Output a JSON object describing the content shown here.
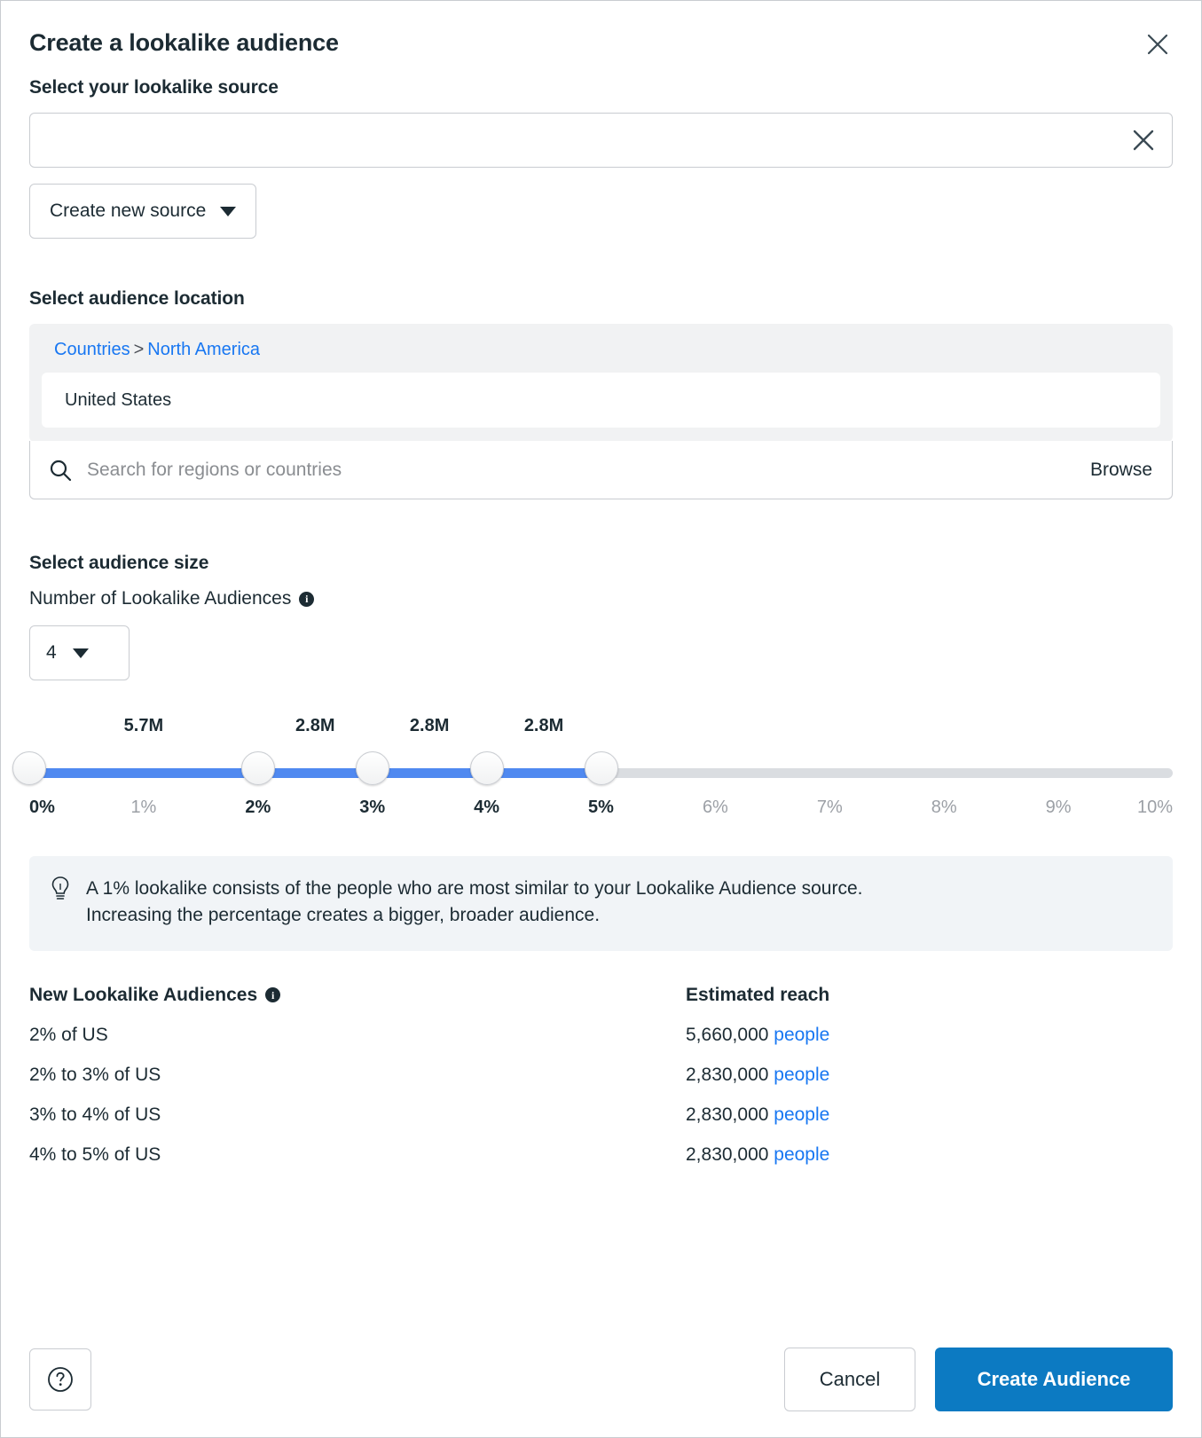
{
  "dialog": {
    "title": "Create a lookalike audience",
    "close_icon": "close-icon"
  },
  "source": {
    "label": "Select your lookalike source",
    "value": "",
    "placeholder": "",
    "clear_icon": "close-icon",
    "create_button": "Create new source"
  },
  "location": {
    "label": "Select audience location",
    "breadcrumb": {
      "root": "Countries",
      "separator": ">",
      "current": "North America"
    },
    "selected": "United States",
    "search_placeholder": "Search for regions or countries",
    "search_value": "",
    "browse_label": "Browse",
    "search_icon": "search-icon"
  },
  "size": {
    "label": "Select audience size",
    "count_label": "Number of Lookalike Audiences",
    "count_value": "4",
    "info_icon": "info-icon",
    "slider": {
      "min_pct": 0,
      "max_pct": 10,
      "handles": [
        0,
        2,
        3,
        4,
        5
      ],
      "segment_values": [
        {
          "label": "5.7M",
          "center_pct": 1
        },
        {
          "label": "2.8M",
          "center_pct": 2.5
        },
        {
          "label": "2.8M",
          "center_pct": 3.5
        },
        {
          "label": "2.8M",
          "center_pct": 4.5
        }
      ],
      "ticks": [
        {
          "label": "0%",
          "pct": 0,
          "active": true
        },
        {
          "label": "1%",
          "pct": 1,
          "active": false
        },
        {
          "label": "2%",
          "pct": 2,
          "active": true
        },
        {
          "label": "3%",
          "pct": 3,
          "active": true
        },
        {
          "label": "4%",
          "pct": 4,
          "active": true
        },
        {
          "label": "5%",
          "pct": 5,
          "active": true
        },
        {
          "label": "6%",
          "pct": 6,
          "active": false
        },
        {
          "label": "7%",
          "pct": 7,
          "active": false
        },
        {
          "label": "8%",
          "pct": 8,
          "active": false
        },
        {
          "label": "9%",
          "pct": 9,
          "active": false
        },
        {
          "label": "10%",
          "pct": 10,
          "active": false
        }
      ]
    }
  },
  "tip": {
    "icon": "lightbulb-icon",
    "line1": "A 1% lookalike consists of the people who are most similar to your Lookalike Audience source.",
    "line2": "Increasing the percentage creates a bigger, broader audience."
  },
  "table": {
    "col1_header": "New Lookalike Audiences",
    "col2_header": "Estimated reach",
    "info_icon": "info-icon",
    "people_suffix": "people",
    "rows": [
      {
        "audience": "2% of US",
        "reach": "5,660,000"
      },
      {
        "audience": "2% to 3% of US",
        "reach": "2,830,000"
      },
      {
        "audience": "3% to 4% of US",
        "reach": "2,830,000"
      },
      {
        "audience": "4% to 5% of US",
        "reach": "2,830,000"
      }
    ]
  },
  "footer": {
    "help_icon": "help-circle-icon",
    "cancel_label": "Cancel",
    "primary_label": "Create Audience"
  },
  "colors": {
    "accent_blue": "#1877f2",
    "slider_fill": "#5089f0",
    "slider_track": "#dadde1",
    "primary_button": "#0c7ac2",
    "text": "#1c2b33",
    "panel_bg": "#f1f2f3",
    "tip_bg": "#f1f4f7"
  }
}
